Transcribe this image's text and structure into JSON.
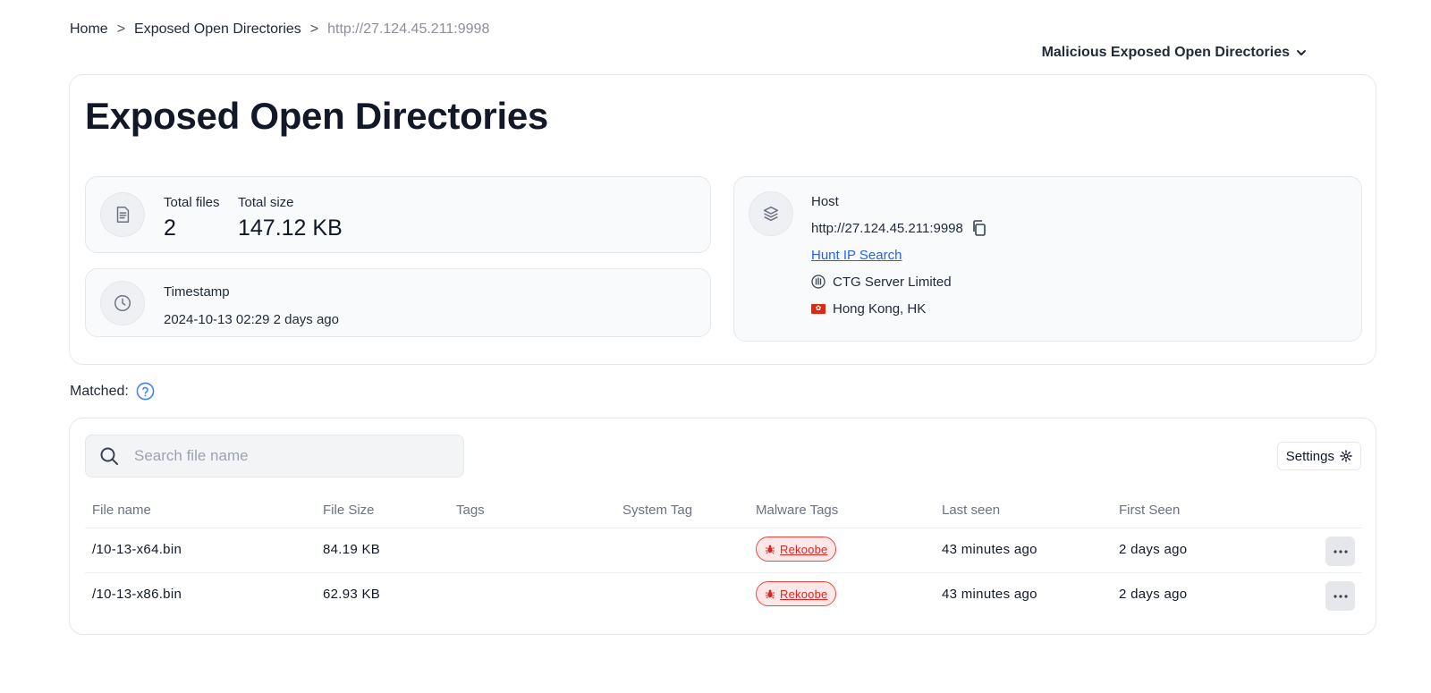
{
  "breadcrumb": {
    "items": [
      "Home",
      "Exposed Open Directories",
      "http://27.124.45.211:9998"
    ],
    "separator": ">"
  },
  "view_selector": {
    "label": "Malicious Exposed Open Directories"
  },
  "page": {
    "title": "Exposed Open Directories"
  },
  "stats": {
    "total_files_label": "Total files",
    "total_files_value": "2",
    "total_size_label": "Total size",
    "total_size_value": "147.12 KB"
  },
  "timestamp": {
    "label": "Timestamp",
    "value": "2024-10-13 02:29 2 days ago"
  },
  "host": {
    "label": "Host",
    "url": "http://27.124.45.211:9998",
    "hunt_link": "Hunt IP Search",
    "organization": "CTG Server Limited",
    "location": "Hong Kong, HK",
    "flag_symbol": "✿"
  },
  "matched": {
    "label": "Matched:"
  },
  "search": {
    "placeholder": "Search file name",
    "value": ""
  },
  "settings": {
    "label": "Settings"
  },
  "table": {
    "columns": [
      "File name",
      "File Size",
      "Tags",
      "System Tag",
      "Malware Tags",
      "Last seen",
      "First Seen"
    ],
    "rows": [
      {
        "file_name": "/10-13-x64.bin",
        "file_size": "84.19 KB",
        "tags": "",
        "system_tag": "",
        "malware_tag": "Rekoobe",
        "last_seen": "43 minutes ago",
        "first_seen": "2 days ago"
      },
      {
        "file_name": "/10-13-x86.bin",
        "file_size": "62.93 KB",
        "tags": "",
        "system_tag": "",
        "malware_tag": "Rekoobe",
        "last_seen": "43 minutes ago",
        "first_seen": "2 days ago"
      }
    ]
  },
  "colors": {
    "link": "#2563eb",
    "malware_tag_text": "#dc2626",
    "malware_tag_bg": "#fde8e8",
    "help_icon": "#3b82f6",
    "flag_red": "#de2910"
  },
  "icons": {
    "files_card": "document-icon",
    "timestamp_card": "clock-icon",
    "host_card": "layers-icon",
    "copy": "copy-icon",
    "organization": "building-icon",
    "location": "hk-flag-icon",
    "help": "help-circle-icon",
    "search": "search-icon",
    "settings": "gear-icon",
    "malware": "bug-icon",
    "row_menu": "more-horizontal-icon",
    "dropdown": "chevron-down-icon"
  }
}
